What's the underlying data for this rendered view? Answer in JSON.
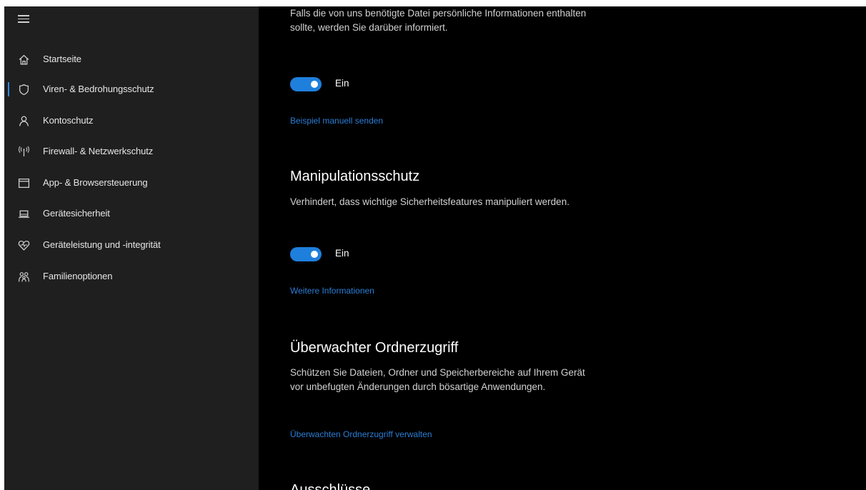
{
  "sidebar": {
    "items": [
      {
        "label": "Startseite",
        "icon": "home-icon"
      },
      {
        "label": "Viren- & Bedrohungsschutz",
        "icon": "shield-icon",
        "active": true
      },
      {
        "label": "Kontoschutz",
        "icon": "person-icon"
      },
      {
        "label": "Firewall- & Netzwerkschutz",
        "icon": "network-icon"
      },
      {
        "label": "App- & Browsersteuerung",
        "icon": "browser-window-icon"
      },
      {
        "label": "Gerätesicherheit",
        "icon": "laptop-icon"
      },
      {
        "label": "Geräteleistung und -integrität",
        "icon": "heart-icon"
      },
      {
        "label": "Familienoptionen",
        "icon": "family-icon"
      }
    ]
  },
  "main": {
    "sample_submission": {
      "description": "Falls die von uns benötigte Datei persönliche Informationen enthalten sollte, werden Sie darüber informiert.",
      "toggle_label": "Ein",
      "toggle_on": true,
      "link": "Beispiel manuell senden"
    },
    "tamper_protection": {
      "title": "Manipulationsschutz",
      "description": "Verhindert, dass wichtige Sicherheitsfeatures manipuliert werden.",
      "toggle_label": "Ein",
      "toggle_on": true,
      "link": "Weitere Informationen"
    },
    "controlled_folder_access": {
      "title": "Überwachter Ordnerzugriff",
      "description": "Schützen Sie Dateien, Ordner und Speicherbereiche auf Ihrem Gerät vor unbefugten Änderungen durch bösartige Anwendungen.",
      "link": "Überwachten Ordnerzugriff verwalten"
    },
    "exclusions": {
      "title": "Ausschlüsse"
    }
  },
  "colors": {
    "accent": "#1f7fdc",
    "link": "#2b7ed6",
    "sidebar_bg": "#1f1f1f",
    "content_bg": "#000000"
  }
}
